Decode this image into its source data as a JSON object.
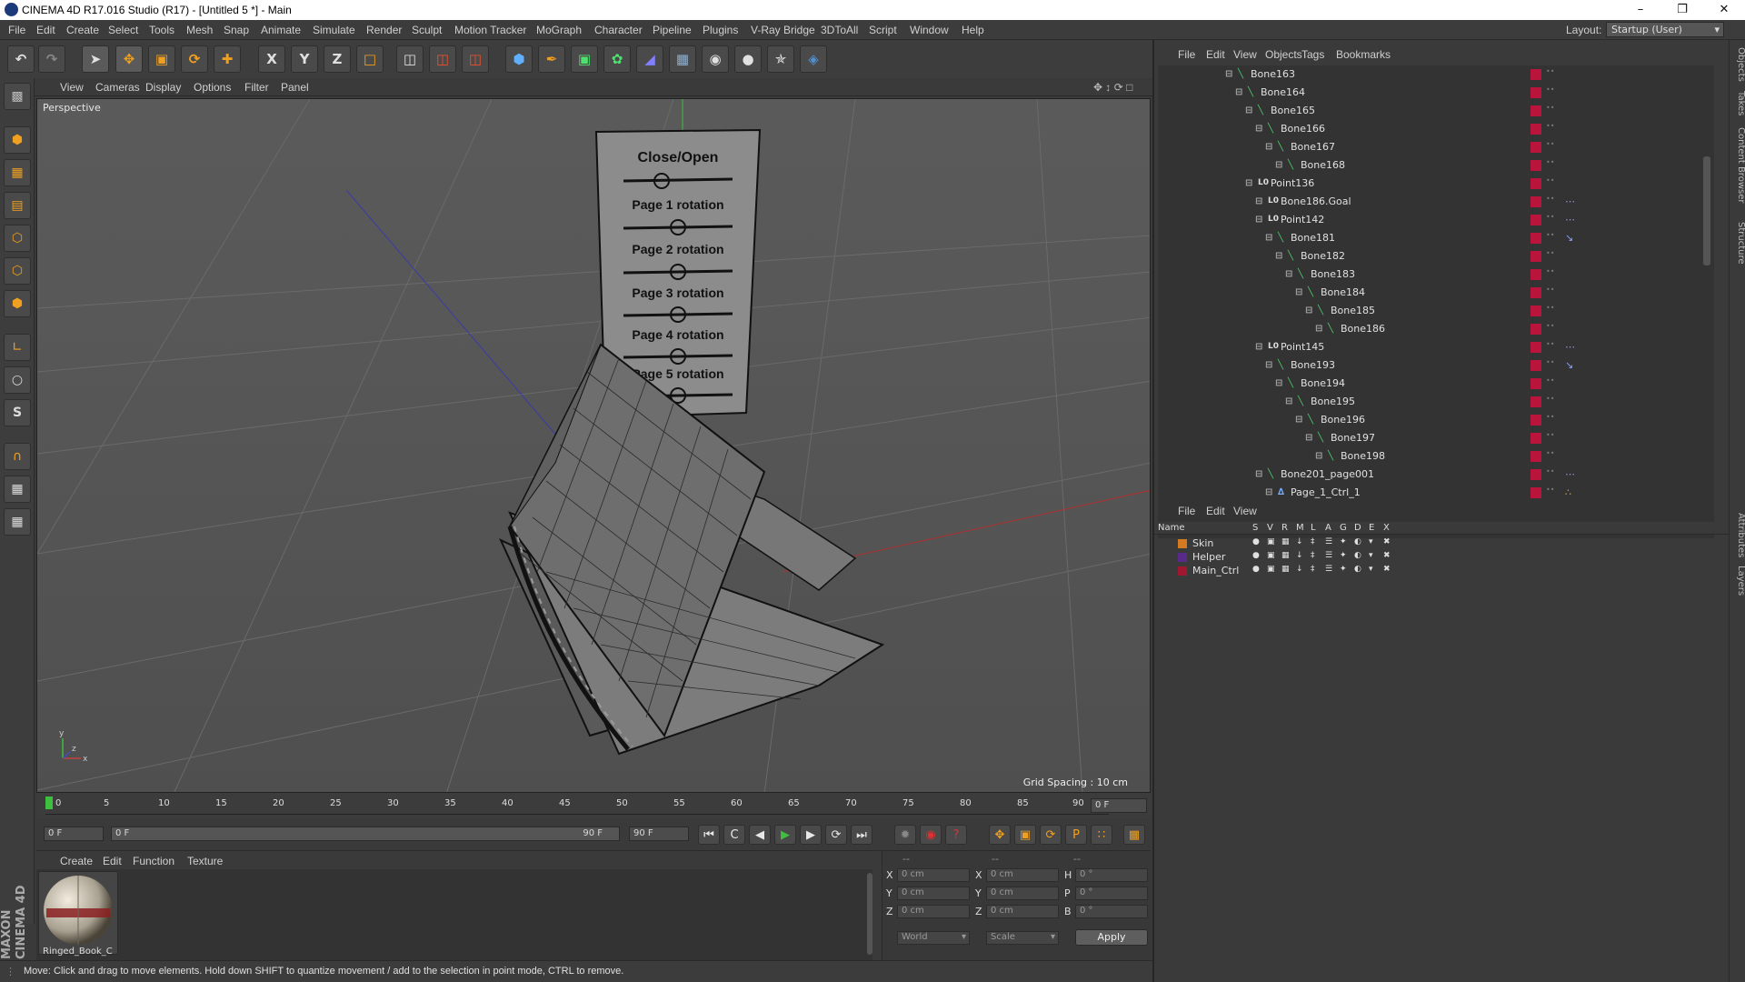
{
  "window": {
    "title": "CINEMA 4D R17.016 Studio (R17) - [Untitled 5 *] - Main",
    "controls": [
      "–",
      "❐",
      "✕"
    ]
  },
  "menubar": {
    "items": [
      "File",
      "Edit",
      "Create",
      "Select",
      "Tools",
      "Mesh",
      "Snap",
      "Animate",
      "Simulate",
      "Render",
      "Sculpt",
      "Motion Tracker",
      "MoGraph",
      "Character",
      "Pipeline",
      "Plugins",
      "V-Ray Bridge",
      "3DToAll",
      "Script",
      "Window",
      "Help"
    ],
    "layout_label": "Layout:",
    "layout_value": "Startup (User)"
  },
  "toolbar": {
    "axis_x": "X",
    "axis_y": "Y",
    "axis_z": "Z"
  },
  "viewport": {
    "menu": [
      "View",
      "Cameras",
      "Display",
      "Options",
      "Filter",
      "Panel"
    ],
    "label": "Perspective",
    "grid_spacing": "Grid Spacing : 10 cm",
    "overlay": {
      "title": "Close/Open",
      "sliders": [
        "Page 1 rotation",
        "Page 2 rotation",
        "Page 3 rotation",
        "Page 4 rotation",
        "Page 5 rotation"
      ]
    },
    "axes": {
      "y": "y",
      "x": "x",
      "z": "z"
    }
  },
  "timeline": {
    "ticks": [
      "0",
      "5",
      "10",
      "15",
      "20",
      "25",
      "30",
      "35",
      "40",
      "45",
      "50",
      "55",
      "60",
      "65",
      "70",
      "75",
      "80",
      "85",
      "90"
    ],
    "current_frame": "0 F"
  },
  "transport": {
    "start_field": "0 F",
    "range_start": "0 F",
    "range_end": "90 F",
    "end_field": "90 F"
  },
  "material_manager": {
    "menu": [
      "Create",
      "Edit",
      "Function",
      "Texture"
    ],
    "materials": [
      {
        "name": "Ringed_Book_C"
      }
    ]
  },
  "coordinates": {
    "header": [
      "--",
      "--",
      "--"
    ],
    "rows": [
      {
        "l1": "X",
        "v1": "0 cm",
        "l2": "X",
        "v2": "0 cm",
        "l3": "H",
        "v3": "0 °"
      },
      {
        "l1": "Y",
        "v1": "0 cm",
        "l2": "Y",
        "v2": "0 cm",
        "l3": "P",
        "v3": "0 °"
      },
      {
        "l1": "Z",
        "v1": "0 cm",
        "l2": "Z",
        "v2": "0 cm",
        "l3": "B",
        "v3": "0 °"
      }
    ],
    "mode1": "World",
    "mode2": "Scale",
    "apply": "Apply"
  },
  "status": {
    "text": "Move: Click and drag to move elements. Hold down SHIFT to quantize movement / add to the selection in point mode, CTRL to remove."
  },
  "branding": {
    "logo": "MAXON CINEMA 4D"
  },
  "object_manager": {
    "menu": [
      "File",
      "Edit",
      "View",
      "Objects",
      "Tags",
      "Bookmarks"
    ],
    "rows": [
      {
        "name": "Bone163",
        "depth": 8,
        "icon": "bone",
        "tag": ""
      },
      {
        "name": "Bone164",
        "depth": 9,
        "icon": "bone",
        "tag": ""
      },
      {
        "name": "Bone165",
        "depth": 10,
        "icon": "bone",
        "tag": ""
      },
      {
        "name": "Bone166",
        "depth": 11,
        "icon": "bone",
        "tag": ""
      },
      {
        "name": "Bone167",
        "depth": 12,
        "icon": "bone",
        "tag": ""
      },
      {
        "name": "Bone168",
        "depth": 13,
        "icon": "bone",
        "tag": ""
      },
      {
        "name": "Point136",
        "depth": 10,
        "icon": "null",
        "tag": ""
      },
      {
        "name": "Bone186.Goal",
        "depth": 11,
        "icon": "null",
        "tag": "ik"
      },
      {
        "name": "Point142",
        "depth": 11,
        "icon": "null",
        "tag": "ik"
      },
      {
        "name": "Bone181",
        "depth": 12,
        "icon": "bone",
        "tag": "pin"
      },
      {
        "name": "Bone182",
        "depth": 13,
        "icon": "bone",
        "tag": ""
      },
      {
        "name": "Bone183",
        "depth": 14,
        "icon": "bone",
        "tag": ""
      },
      {
        "name": "Bone184",
        "depth": 15,
        "icon": "bone",
        "tag": ""
      },
      {
        "name": "Bone185",
        "depth": 16,
        "icon": "bone",
        "tag": ""
      },
      {
        "name": "Bone186",
        "depth": 17,
        "icon": "bone",
        "tag": ""
      },
      {
        "name": "Point145",
        "depth": 11,
        "icon": "null",
        "tag": "ik"
      },
      {
        "name": "Bone193",
        "depth": 12,
        "icon": "bone",
        "tag": "pin"
      },
      {
        "name": "Bone194",
        "depth": 13,
        "icon": "bone",
        "tag": ""
      },
      {
        "name": "Bone195",
        "depth": 14,
        "icon": "bone",
        "tag": ""
      },
      {
        "name": "Bone196",
        "depth": 15,
        "icon": "bone",
        "tag": ""
      },
      {
        "name": "Bone197",
        "depth": 16,
        "icon": "bone",
        "tag": ""
      },
      {
        "name": "Bone198",
        "depth": 17,
        "icon": "bone",
        "tag": ""
      },
      {
        "name": "Bone201_page001",
        "depth": 11,
        "icon": "bone",
        "tag": "ik"
      },
      {
        "name": "Page_1_Ctrl_1",
        "depth": 12,
        "icon": "ctrl",
        "tag": "ctrl"
      }
    ]
  },
  "layer_manager": {
    "menu": [
      "File",
      "Edit",
      "View"
    ],
    "columns": [
      "Name",
      "S",
      "V",
      "R",
      "M",
      "L",
      "A",
      "G",
      "D",
      "E",
      "X"
    ],
    "layers": [
      {
        "name": "Skin",
        "color": "#d47a20"
      },
      {
        "name": "Helper",
        "color": "#5a2a8a"
      },
      {
        "name": "Main_Ctrl",
        "color": "#a01830"
      }
    ]
  },
  "right_tabs": [
    "Objects",
    "Takes",
    "Content Browser",
    "Structure",
    "Attributes",
    "Layers"
  ],
  "colors": {
    "accent": "#f0a020",
    "bone": "#4ed06a",
    "layer_red": "#b8143c"
  }
}
